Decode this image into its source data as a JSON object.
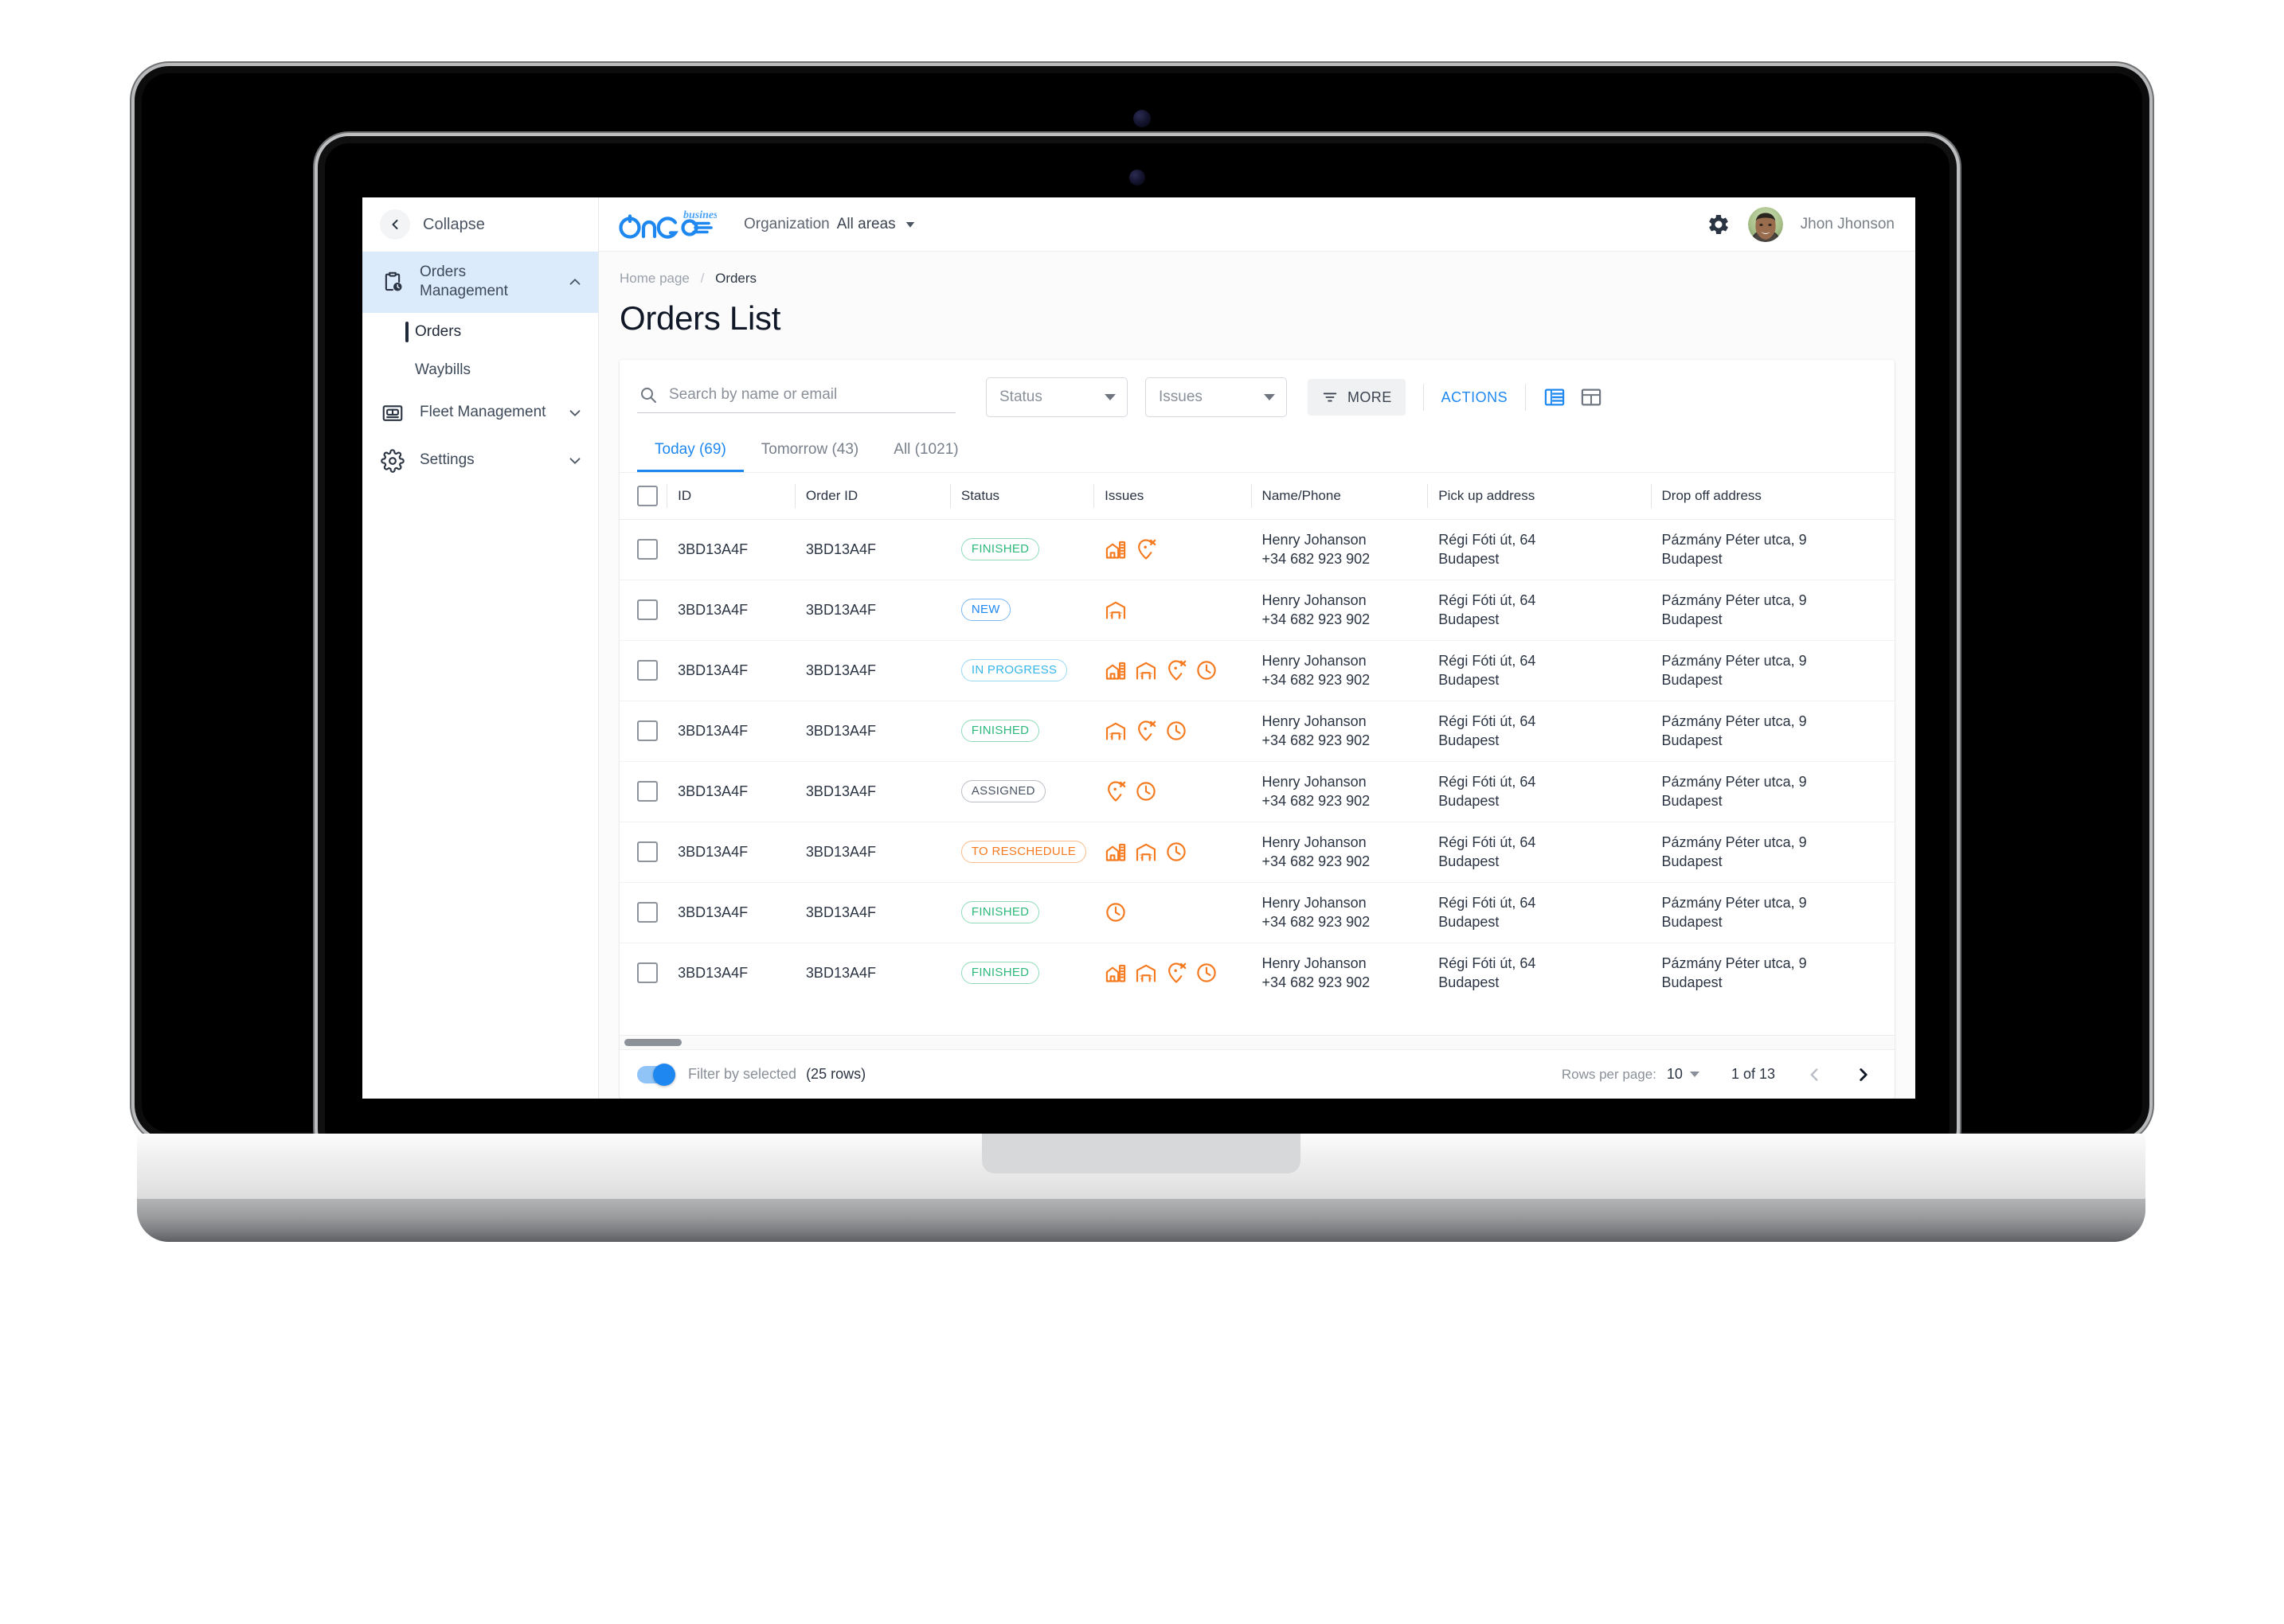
{
  "brand": {
    "logo_text": "OnGo",
    "logo_sup": "business",
    "accent_blue": "#1e88f0",
    "issue_orange": "#f57a1f"
  },
  "sidebar": {
    "collapse_label": "Collapse",
    "items": [
      {
        "label": "Orders Management",
        "icon": "clipboard-clock-icon",
        "active": true,
        "expanded": true
      },
      {
        "label": "Orders",
        "sub": true,
        "active": true
      },
      {
        "label": "Waybills",
        "sub": true,
        "active": false
      },
      {
        "label": "Fleet Management",
        "icon": "truck-icon",
        "active": false,
        "expanded": false
      },
      {
        "label": "Settings",
        "icon": "gear-icon",
        "active": false,
        "expanded": false
      }
    ]
  },
  "topbar": {
    "organization_label": "Organization",
    "organization_value": "All areas",
    "settings_icon": "gear-icon",
    "user_name": "Jhon Jhonson"
  },
  "breadcrumb": {
    "home": "Home page",
    "separator": "/",
    "current": "Orders"
  },
  "page_title": "Orders List",
  "toolbar": {
    "search_placeholder": "Search by name or email",
    "search_value": "",
    "status_filter": "Status",
    "issues_filter": "Issues",
    "more_label": "MORE",
    "actions_label": "ACTIONS",
    "view_list_icon": "list-view-icon",
    "view_grid_icon": "grid-view-icon"
  },
  "tabs": [
    {
      "label": "Today (69)",
      "active": true
    },
    {
      "label": "Tomorrow (43)",
      "active": false
    },
    {
      "label": "All (1021)",
      "active": false
    }
  ],
  "table": {
    "columns": [
      "ID",
      "Order ID",
      "Status",
      "Issues",
      "Name/Phone",
      "Pick up address",
      "Drop off address"
    ],
    "rows": [
      {
        "id": "3BD13A4F",
        "order_id": "3BD13A4F",
        "status": "FINISHED",
        "status_kind": "finished",
        "issues": [
          "building-icon",
          "pin-x-icon"
        ],
        "name": "Henry Johanson",
        "phone": "+34 682 923 902",
        "pickup_street": "Régi Fóti út, 64",
        "pickup_city": "Budapest",
        "dropoff_street": "Pázmány Péter utca, 9",
        "dropoff_city": "Budapest"
      },
      {
        "id": "3BD13A4F",
        "order_id": "3BD13A4F",
        "status": "NEW",
        "status_kind": "new",
        "issues": [
          "warehouse-icon"
        ],
        "name": "Henry Johanson",
        "phone": "+34 682 923 902",
        "pickup_street": "Régi Fóti út, 64",
        "pickup_city": "Budapest",
        "dropoff_street": "Pázmány Péter utca, 9",
        "dropoff_city": "Budapest"
      },
      {
        "id": "3BD13A4F",
        "order_id": "3BD13A4F",
        "status": "IN PROGRESS",
        "status_kind": "inprogress",
        "issues": [
          "building-icon",
          "warehouse-icon",
          "pin-x-icon",
          "clock-icon"
        ],
        "name": "Henry Johanson",
        "phone": "+34 682 923 902",
        "pickup_street": "Régi Fóti út, 64",
        "pickup_city": "Budapest",
        "dropoff_street": "Pázmány Péter utca, 9",
        "dropoff_city": "Budapest"
      },
      {
        "id": "3BD13A4F",
        "order_id": "3BD13A4F",
        "status": "FINISHED",
        "status_kind": "finished",
        "issues": [
          "warehouse-icon",
          "pin-x-icon",
          "clock-icon"
        ],
        "name": "Henry Johanson",
        "phone": "+34 682 923 902",
        "pickup_street": "Régi Fóti út, 64",
        "pickup_city": "Budapest",
        "dropoff_street": "Pázmány Péter utca, 9",
        "dropoff_city": "Budapest"
      },
      {
        "id": "3BD13A4F",
        "order_id": "3BD13A4F",
        "status": "ASSIGNED",
        "status_kind": "assigned",
        "issues": [
          "pin-x-icon",
          "clock-icon"
        ],
        "name": "Henry Johanson",
        "phone": "+34 682 923 902",
        "pickup_street": "Régi Fóti út, 64",
        "pickup_city": "Budapest",
        "dropoff_street": "Pázmány Péter utca, 9",
        "dropoff_city": "Budapest"
      },
      {
        "id": "3BD13A4F",
        "order_id": "3BD13A4F",
        "status": "TO RESCHEDULE",
        "status_kind": "reschedule",
        "issues": [
          "building-icon",
          "warehouse-icon",
          "clock-icon"
        ],
        "name": "Henry Johanson",
        "phone": "+34 682 923 902",
        "pickup_street": "Régi Fóti út, 64",
        "pickup_city": "Budapest",
        "dropoff_street": "Pázmány Péter utca, 9",
        "dropoff_city": "Budapest"
      },
      {
        "id": "3BD13A4F",
        "order_id": "3BD13A4F",
        "status": "FINISHED",
        "status_kind": "finished",
        "issues": [
          "clock-icon"
        ],
        "name": "Henry Johanson",
        "phone": "+34 682 923 902",
        "pickup_street": "Régi Fóti út, 64",
        "pickup_city": "Budapest",
        "dropoff_street": "Pázmány Péter utca, 9",
        "dropoff_city": "Budapest"
      },
      {
        "id": "3BD13A4F",
        "order_id": "3BD13A4F",
        "status": "FINISHED",
        "status_kind": "finished",
        "issues": [
          "building-icon",
          "warehouse-icon",
          "pin-x-icon",
          "clock-icon"
        ],
        "name": "Henry Johanson",
        "phone": "+34 682 923 902",
        "pickup_street": "Régi Fóti út, 64",
        "pickup_city": "Budapest",
        "dropoff_street": "Pázmány Péter utca, 9",
        "dropoff_city": "Budapest"
      }
    ]
  },
  "status_colors": {
    "finished": {
      "text": "#2db87b",
      "border": "#8fdcbb"
    },
    "new": {
      "text": "#1e88f0",
      "border": "#7ab8f2"
    },
    "inprogress": {
      "text": "#35b6e8",
      "border": "#9ad9f2"
    },
    "assigned": {
      "text": "#4b5563",
      "border": "#b9bec5"
    },
    "reschedule": {
      "text": "#f57a1f",
      "border": "#f9bc8a"
    }
  },
  "footer": {
    "filter_toggle_label": "Filter by selected",
    "filter_rows_count": "(25 rows)",
    "filter_toggle_on": true,
    "rows_per_page_label": "Rows per page:",
    "rows_per_page_value": "10",
    "page_indicator": "1 of 13",
    "prev_label": "prev-page-button",
    "next_label": "next-page-button"
  }
}
